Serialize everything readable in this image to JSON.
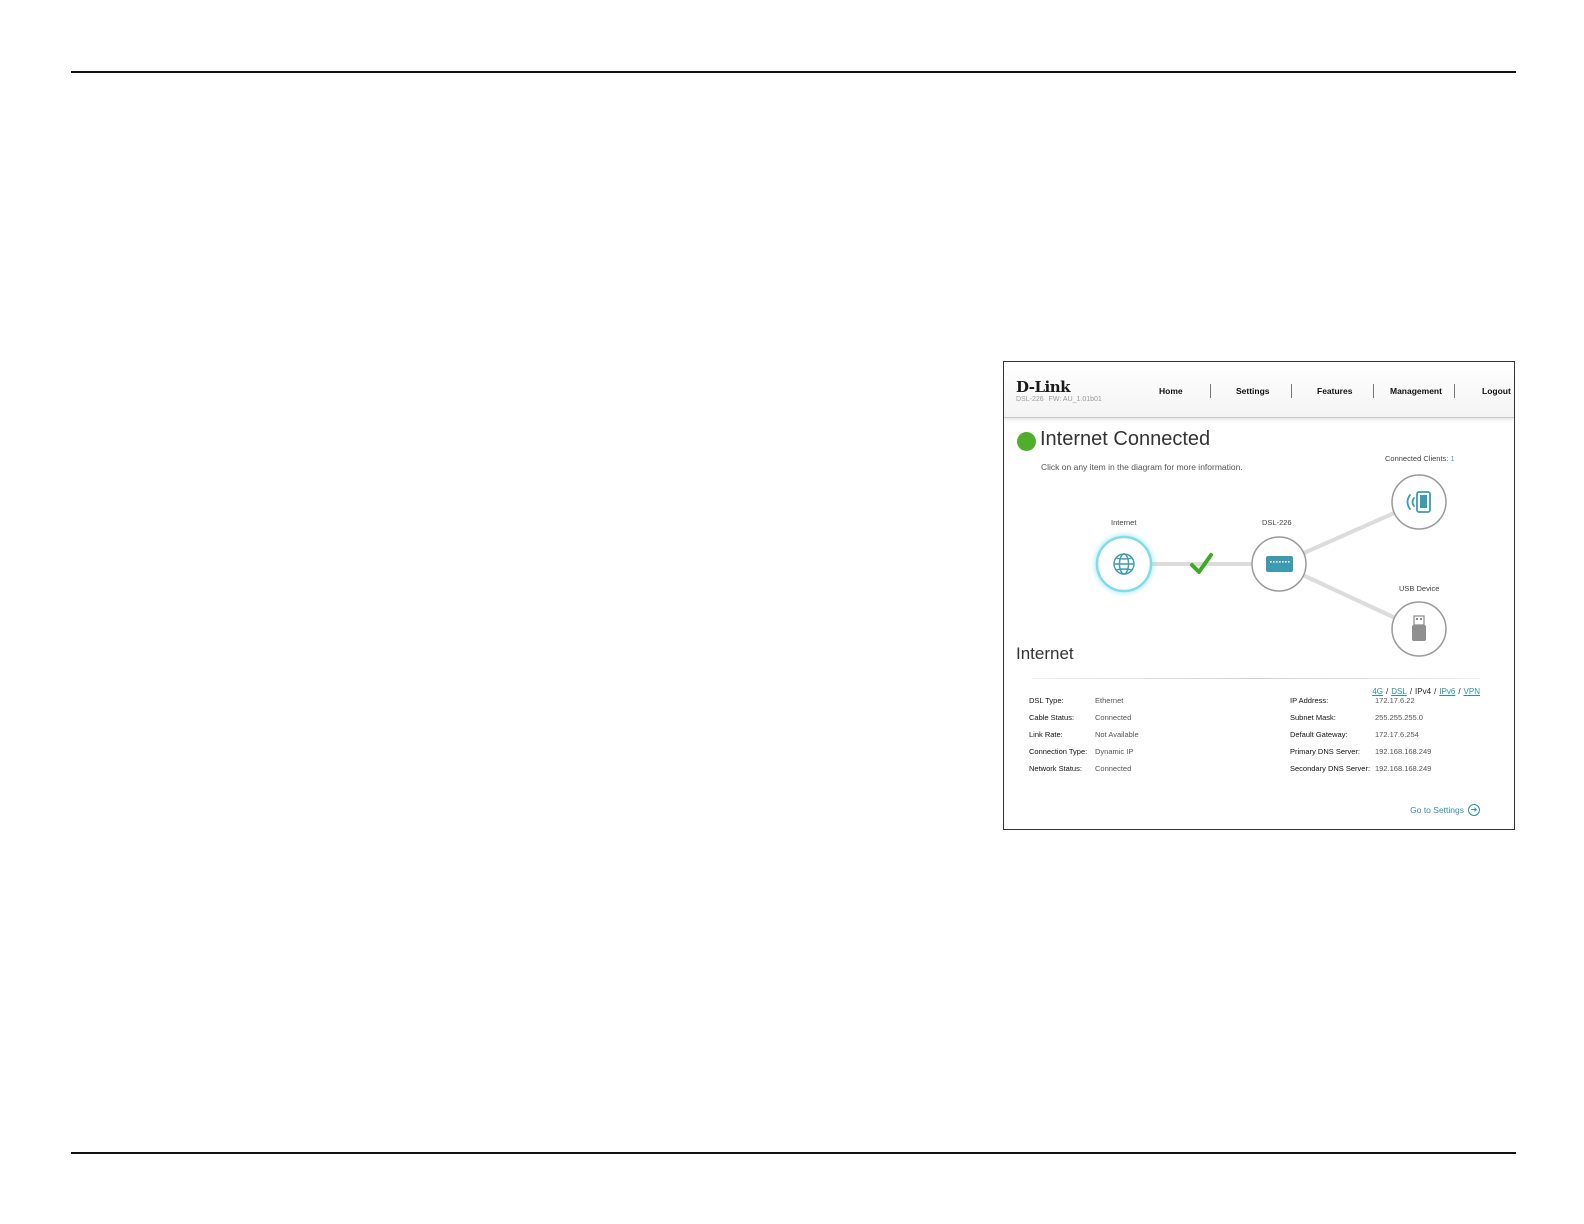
{
  "header": {
    "brand": "D-Link",
    "model": "DSL-226",
    "firmware": "FW: AU_1.01b01",
    "nav": [
      "Home",
      "Settings",
      "Features",
      "Management",
      "Logout"
    ]
  },
  "status": {
    "title": "Internet Connected",
    "hint": "Click on any item in the diagram for more information."
  },
  "diagram": {
    "internet_label": "Internet",
    "router_label": "DSL-226",
    "clients_label": "Connected Clients:",
    "clients_count": "1",
    "usb_label": "USB Device"
  },
  "section": {
    "title": "Internet",
    "modes": [
      "4G",
      "DSL",
      "IPv4",
      "IPv6",
      "VPN"
    ],
    "active_mode": "IPv4"
  },
  "left_info": [
    {
      "label": "DSL Type:",
      "value": "Ethernet"
    },
    {
      "label": "Cable Status:",
      "value": "Connected"
    },
    {
      "label": "Link Rate:",
      "value": "Not Available"
    },
    {
      "label": "Connection Type:",
      "value": "Dynamic IP"
    },
    {
      "label": "Network Status:",
      "value": "Connected"
    }
  ],
  "right_info": [
    {
      "label": "IP Address:",
      "value": "172.17.6.22"
    },
    {
      "label": "Subnet Mask:",
      "value": "255.255.255.0"
    },
    {
      "label": "Default Gateway:",
      "value": "172.17.6.254"
    },
    {
      "label": "Primary DNS Server:",
      "value": "192.168.168.249"
    },
    {
      "label": "Secondary DNS Server:",
      "value": "192.168.168.249"
    }
  ],
  "footer": {
    "goto_label": "Go to Settings"
  },
  "colors": {
    "accent": "#2f8fa3",
    "status_green": "#4fae2b"
  }
}
